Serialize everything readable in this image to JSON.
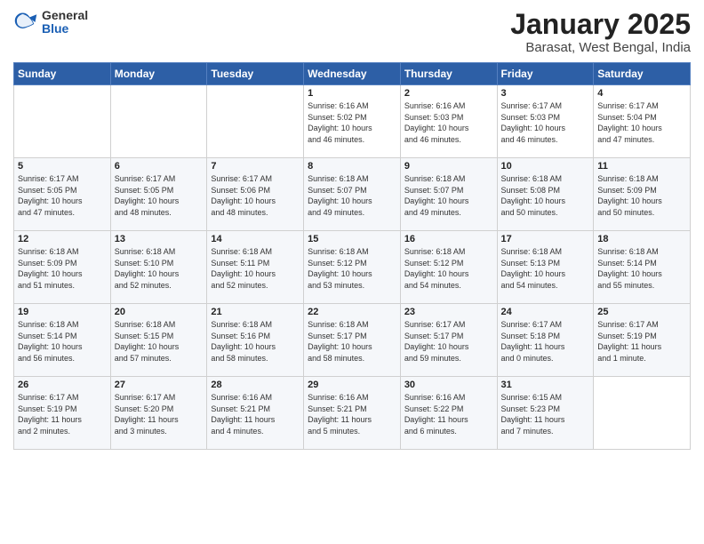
{
  "logo": {
    "general": "General",
    "blue": "Blue"
  },
  "header": {
    "title": "January 2025",
    "location": "Barasat, West Bengal, India"
  },
  "weekdays": [
    "Sunday",
    "Monday",
    "Tuesday",
    "Wednesday",
    "Thursday",
    "Friday",
    "Saturday"
  ],
  "weeks": [
    [
      {
        "day": "",
        "info": ""
      },
      {
        "day": "",
        "info": ""
      },
      {
        "day": "",
        "info": ""
      },
      {
        "day": "1",
        "info": "Sunrise: 6:16 AM\nSunset: 5:02 PM\nDaylight: 10 hours\nand 46 minutes."
      },
      {
        "day": "2",
        "info": "Sunrise: 6:16 AM\nSunset: 5:03 PM\nDaylight: 10 hours\nand 46 minutes."
      },
      {
        "day": "3",
        "info": "Sunrise: 6:17 AM\nSunset: 5:03 PM\nDaylight: 10 hours\nand 46 minutes."
      },
      {
        "day": "4",
        "info": "Sunrise: 6:17 AM\nSunset: 5:04 PM\nDaylight: 10 hours\nand 47 minutes."
      }
    ],
    [
      {
        "day": "5",
        "info": "Sunrise: 6:17 AM\nSunset: 5:05 PM\nDaylight: 10 hours\nand 47 minutes."
      },
      {
        "day": "6",
        "info": "Sunrise: 6:17 AM\nSunset: 5:05 PM\nDaylight: 10 hours\nand 48 minutes."
      },
      {
        "day": "7",
        "info": "Sunrise: 6:17 AM\nSunset: 5:06 PM\nDaylight: 10 hours\nand 48 minutes."
      },
      {
        "day": "8",
        "info": "Sunrise: 6:18 AM\nSunset: 5:07 PM\nDaylight: 10 hours\nand 49 minutes."
      },
      {
        "day": "9",
        "info": "Sunrise: 6:18 AM\nSunset: 5:07 PM\nDaylight: 10 hours\nand 49 minutes."
      },
      {
        "day": "10",
        "info": "Sunrise: 6:18 AM\nSunset: 5:08 PM\nDaylight: 10 hours\nand 50 minutes."
      },
      {
        "day": "11",
        "info": "Sunrise: 6:18 AM\nSunset: 5:09 PM\nDaylight: 10 hours\nand 50 minutes."
      }
    ],
    [
      {
        "day": "12",
        "info": "Sunrise: 6:18 AM\nSunset: 5:09 PM\nDaylight: 10 hours\nand 51 minutes."
      },
      {
        "day": "13",
        "info": "Sunrise: 6:18 AM\nSunset: 5:10 PM\nDaylight: 10 hours\nand 52 minutes."
      },
      {
        "day": "14",
        "info": "Sunrise: 6:18 AM\nSunset: 5:11 PM\nDaylight: 10 hours\nand 52 minutes."
      },
      {
        "day": "15",
        "info": "Sunrise: 6:18 AM\nSunset: 5:12 PM\nDaylight: 10 hours\nand 53 minutes."
      },
      {
        "day": "16",
        "info": "Sunrise: 6:18 AM\nSunset: 5:12 PM\nDaylight: 10 hours\nand 54 minutes."
      },
      {
        "day": "17",
        "info": "Sunrise: 6:18 AM\nSunset: 5:13 PM\nDaylight: 10 hours\nand 54 minutes."
      },
      {
        "day": "18",
        "info": "Sunrise: 6:18 AM\nSunset: 5:14 PM\nDaylight: 10 hours\nand 55 minutes."
      }
    ],
    [
      {
        "day": "19",
        "info": "Sunrise: 6:18 AM\nSunset: 5:14 PM\nDaylight: 10 hours\nand 56 minutes."
      },
      {
        "day": "20",
        "info": "Sunrise: 6:18 AM\nSunset: 5:15 PM\nDaylight: 10 hours\nand 57 minutes."
      },
      {
        "day": "21",
        "info": "Sunrise: 6:18 AM\nSunset: 5:16 PM\nDaylight: 10 hours\nand 58 minutes."
      },
      {
        "day": "22",
        "info": "Sunrise: 6:18 AM\nSunset: 5:17 PM\nDaylight: 10 hours\nand 58 minutes."
      },
      {
        "day": "23",
        "info": "Sunrise: 6:17 AM\nSunset: 5:17 PM\nDaylight: 10 hours\nand 59 minutes."
      },
      {
        "day": "24",
        "info": "Sunrise: 6:17 AM\nSunset: 5:18 PM\nDaylight: 11 hours\nand 0 minutes."
      },
      {
        "day": "25",
        "info": "Sunrise: 6:17 AM\nSunset: 5:19 PM\nDaylight: 11 hours\nand 1 minute."
      }
    ],
    [
      {
        "day": "26",
        "info": "Sunrise: 6:17 AM\nSunset: 5:19 PM\nDaylight: 11 hours\nand 2 minutes."
      },
      {
        "day": "27",
        "info": "Sunrise: 6:17 AM\nSunset: 5:20 PM\nDaylight: 11 hours\nand 3 minutes."
      },
      {
        "day": "28",
        "info": "Sunrise: 6:16 AM\nSunset: 5:21 PM\nDaylight: 11 hours\nand 4 minutes."
      },
      {
        "day": "29",
        "info": "Sunrise: 6:16 AM\nSunset: 5:21 PM\nDaylight: 11 hours\nand 5 minutes."
      },
      {
        "day": "30",
        "info": "Sunrise: 6:16 AM\nSunset: 5:22 PM\nDaylight: 11 hours\nand 6 minutes."
      },
      {
        "day": "31",
        "info": "Sunrise: 6:15 AM\nSunset: 5:23 PM\nDaylight: 11 hours\nand 7 minutes."
      },
      {
        "day": "",
        "info": ""
      }
    ]
  ]
}
